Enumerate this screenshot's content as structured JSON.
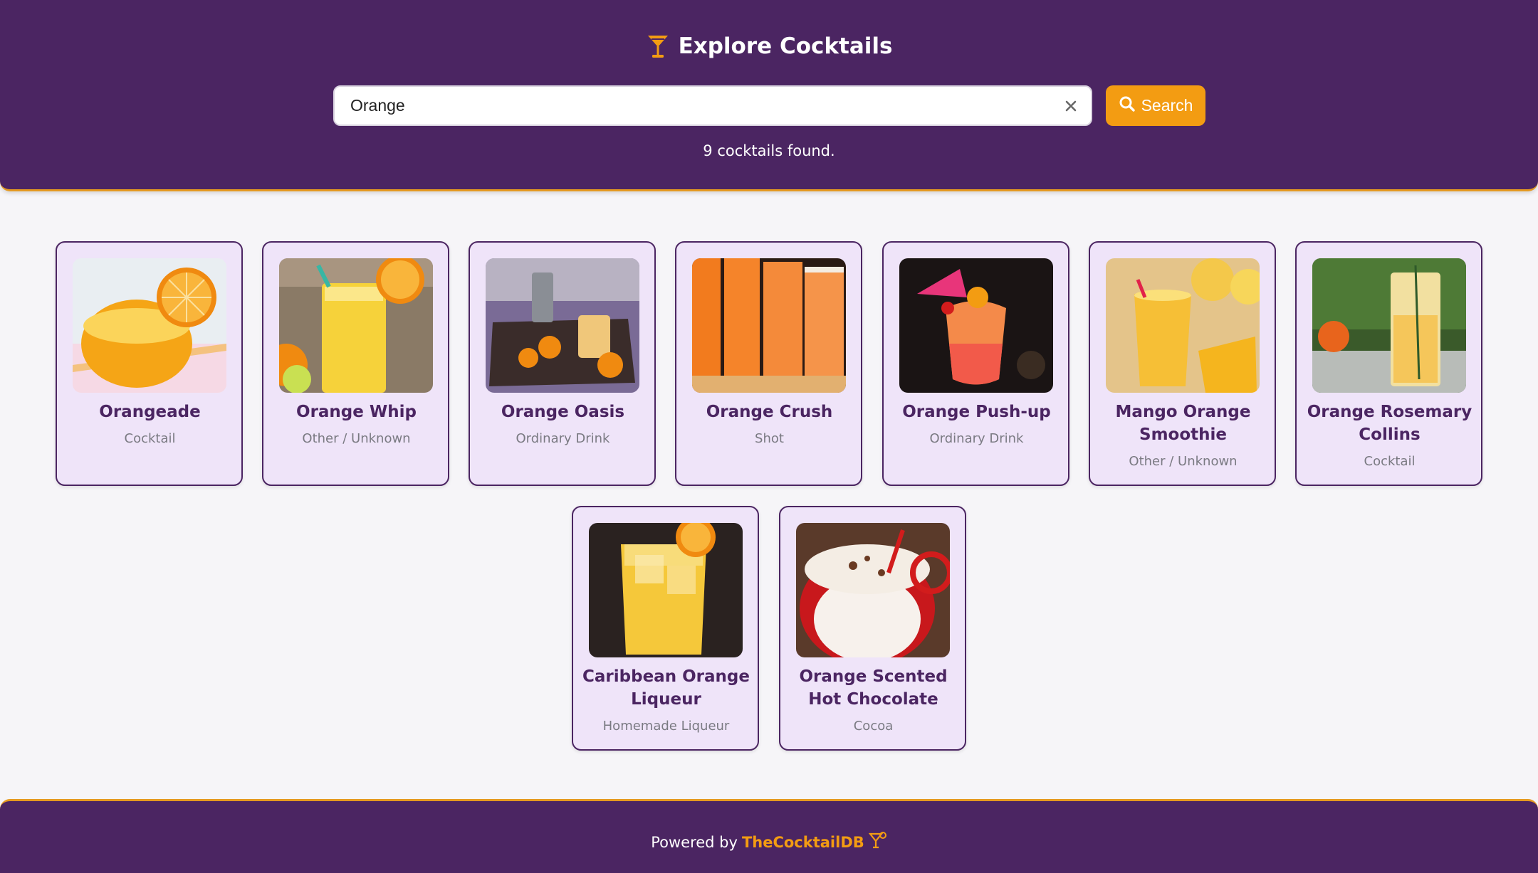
{
  "header": {
    "title": "Explore Cocktails",
    "title_icon": "cocktail-glass-icon",
    "search": {
      "value": "Orange",
      "placeholder": ""
    },
    "clear_icon": "close-icon",
    "search_button_label": "Search",
    "search_button_icon": "search-icon",
    "result_count": "9 cocktails found."
  },
  "cards": [
    {
      "name": "Orangeade",
      "category": "Cocktail",
      "image": "orangeade-photo"
    },
    {
      "name": "Orange Whip",
      "category": "Other / Unknown",
      "image": "orange-whip-photo"
    },
    {
      "name": "Orange Oasis",
      "category": "Ordinary Drink",
      "image": "orange-oasis-photo"
    },
    {
      "name": "Orange Crush",
      "category": "Shot",
      "image": "orange-crush-photo"
    },
    {
      "name": "Orange Push-up",
      "category": "Ordinary Drink",
      "image": "orange-push-up-photo"
    },
    {
      "name": "Mango Orange Smoothie",
      "category": "Other / Unknown",
      "image": "mango-orange-smoothie-photo"
    },
    {
      "name": "Orange Rosemary Collins",
      "category": "Cocktail",
      "image": "orange-rosemary-collins-photo"
    },
    {
      "name": "Caribbean Orange Liqueur",
      "category": "Homemade Liqueur",
      "image": "caribbean-orange-liqueur-photo"
    },
    {
      "name": "Orange Scented Hot Chocolate",
      "category": "Cocoa",
      "image": "orange-scented-hot-chocolate-photo"
    }
  ],
  "footer": {
    "prefix": "Powered by",
    "link_label": "TheCocktailDB",
    "icon": "cocktail-glass-icon"
  },
  "colors": {
    "primary": "#4b2562",
    "accent": "#f39c12",
    "card_bg": "#efe4f9",
    "page_bg": "#f6f5f8"
  }
}
